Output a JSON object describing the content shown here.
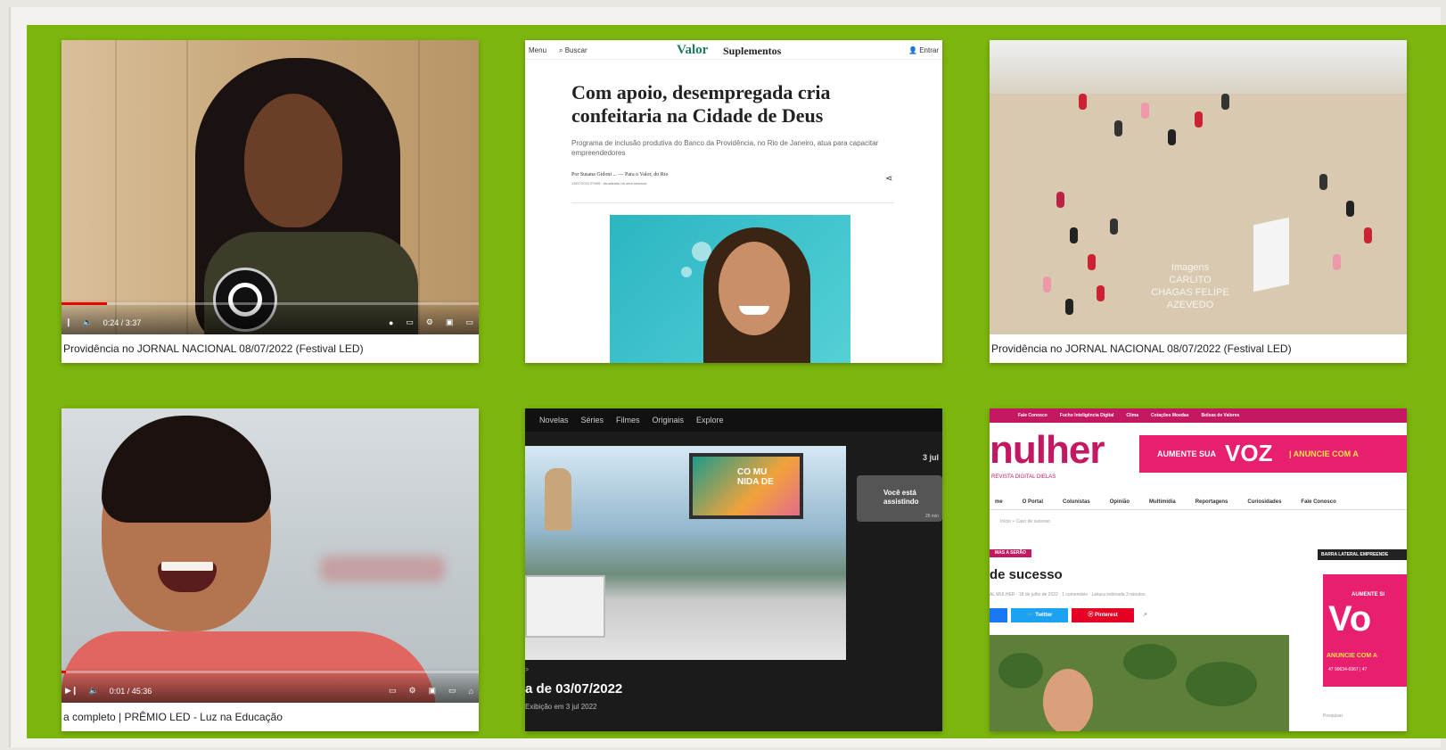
{
  "cards": {
    "c1": {
      "caption": "Providência no JORNAL NACIONAL 08/07/2022 (Festival LED)",
      "time": "0:24 / 3:37",
      "progress": 0.11
    },
    "c2": {
      "menu": "Menu",
      "search": "Buscar",
      "brand": "Valor",
      "section": "Suplementos",
      "login": "Entrar",
      "headline": "Com apoio, desempregada cria confeitaria na Cidade de Deus",
      "subhead": "Programa de inclusão produtiva do Banco da Providência, no Rio de Janeiro, atua para capacitar empreendedores",
      "byline": "Por Susana Gidoni ... — Para o Valor, do Rio",
      "dateline": "13/07/2022 07h05 · Atualizado há uma semana"
    },
    "c3": {
      "credit": "Imagens CARLITO CHAGAS FELIPE AZEVEDO",
      "caption": "Providência no JORNAL NACIONAL 08/07/2022 (Festival LED)"
    },
    "c4": {
      "caption": "a completo | PRÊMIO LED - Luz na Educação",
      "time": "0:01 / 45:36",
      "progress": 0.01
    },
    "c5": {
      "nav": [
        "Novelas",
        "Séries",
        "Filmes",
        "Originais",
        "Explore"
      ],
      "date": "3 jul",
      "screen_text": "CO MU NIDA DE",
      "thumb_title": "Você está assistindo",
      "thumb_dur": "26 min",
      "breadcrumb": "?",
      "episode_title": "a de 03/07/2022",
      "episode_sub": "Exibição em 3 jul 2022"
    },
    "c6": {
      "topbar": [
        "Fale Conosco",
        "Fucho Inteligência Digital",
        "Clima",
        "Cotações Moedas",
        "Bolsas de Valores"
      ],
      "logo": "nulher",
      "tagline": "REVISTA DIGITAL DIELAS",
      "banner_a": "AUMENTE SUA",
      "banner_voz": "VOZ",
      "banner_b": "| ANUNCIE COM A",
      "menu": [
        "me",
        "O Portal",
        "Colunistas",
        "Opinião",
        "Multimídia",
        "Reportagens",
        "Curiosidades",
        "Fale Conosco"
      ],
      "crumbs": "Início » Caso de sucesso",
      "badge": "MAS A SERÃO",
      "title": "de sucesso",
      "meta": "AL MULHER · 18 de julho de 2022 · 1 comentário · Leitura estimada 3 minutos",
      "twitter": "Twitter",
      "pinterest": "Pinterest",
      "side_label": "BARRA LATERAL EMPREENDE",
      "ad_top": "AUMENTE SI",
      "ad_big": "Vo",
      "ad_cta": "ANUNCIE COM A",
      "ad_phone": "47 99634-6967 | 47",
      "search": "Pesquisar"
    }
  },
  "colors": {
    "board": "#7cb50e",
    "magenta": "#c41862",
    "valor_green": "#1c7a61"
  }
}
